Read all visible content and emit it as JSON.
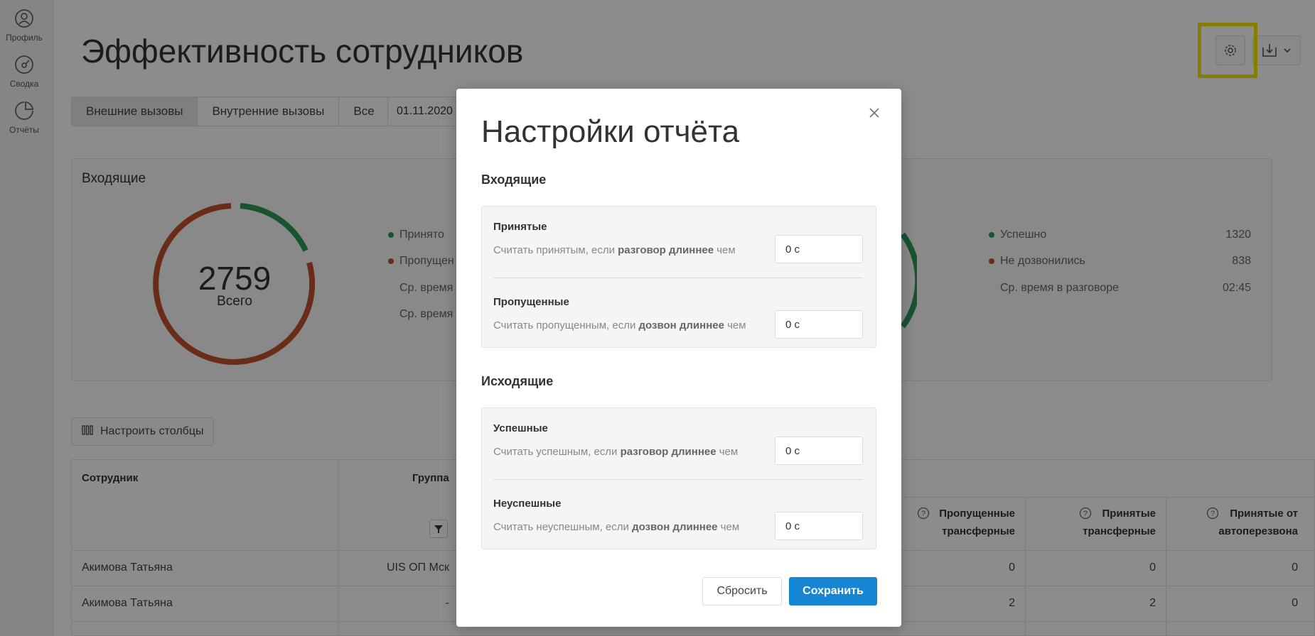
{
  "sidebar": {
    "items": [
      {
        "label": "Профиль",
        "icon": "user-icon"
      },
      {
        "label": "Сводка",
        "icon": "dashboard-icon"
      },
      {
        "label": "Отчёты",
        "icon": "reports-icon"
      }
    ]
  },
  "page": {
    "title": "Эффективность сотрудников",
    "tabs": [
      {
        "label": "Внешние вызовы",
        "active": true
      },
      {
        "label": "Внутренние вызовы",
        "active": false
      },
      {
        "label": "Все",
        "active": false
      }
    ],
    "date": "01.11.2020"
  },
  "incoming_card": {
    "title": "Входящие",
    "total": "2759",
    "total_label": "Всего",
    "legend": [
      {
        "label": "Принято",
        "color": "#2e9a5a"
      },
      {
        "label": "Пропущен",
        "color": "#c0502e"
      },
      {
        "label": "Ср. время",
        "color": ""
      },
      {
        "label": "Ср. время",
        "color": ""
      }
    ]
  },
  "outgoing_card": {
    "legend": [
      {
        "label": "Успешно",
        "value": "1320",
        "color": "#2e9a5a"
      },
      {
        "label": "Не дозвонились",
        "value": "838",
        "color": "#c0502e"
      },
      {
        "label": "Ср. время в разговоре",
        "value": "02:45",
        "color": ""
      }
    ]
  },
  "table": {
    "configure_label": "Настроить столбцы",
    "headers": {
      "employee": "Сотрудник",
      "group": "Группа",
      "missed_transfer_1": "Пропущенные",
      "missed_transfer_2": "трансферные",
      "accepted_transfer_1": "Принятые",
      "accepted_transfer_2": "трансферные",
      "accepted_auto_1": "Принятые от",
      "accepted_auto_2": "автоперезвона"
    },
    "rows": [
      {
        "employee": "Акимова Татьяна",
        "group": "UIS ОП Мск",
        "missed": "0",
        "accepted": "0",
        "auto": "0"
      },
      {
        "employee": "Акимова Татьяна",
        "group": "-",
        "missed": "2",
        "accepted": "2",
        "auto": "0"
      }
    ]
  },
  "modal": {
    "title": "Настройки отчёта",
    "incoming_title": "Входящие",
    "outgoing_title": "Исходящие",
    "accepted": {
      "title": "Принятые",
      "desc_pre": "Считать принятым, если ",
      "desc_bold": "разговор длиннее",
      "desc_post": " чем",
      "value": "0 с"
    },
    "missed": {
      "title": "Пропущенные",
      "desc_pre": "Считать пропущенным, если ",
      "desc_bold": "дозвон длиннее",
      "desc_post": " чем",
      "value": "0 с"
    },
    "successful": {
      "title": "Успешные",
      "desc_pre": "Считать успешным, если ",
      "desc_bold": "разговор длиннее",
      "desc_post": " чем",
      "value": "0 с"
    },
    "unsuccessful": {
      "title": "Неуспешные",
      "desc_pre": "Считать неуспешным, если ",
      "desc_bold": "дозвон длиннее",
      "desc_post": " чем",
      "value": "0 с"
    },
    "reset_label": "Сбросить",
    "save_label": "Сохранить"
  },
  "colors": {
    "accent": "#1686d4",
    "success": "#2e9a5a",
    "danger": "#c0502e",
    "highlight": "#f5e600"
  }
}
